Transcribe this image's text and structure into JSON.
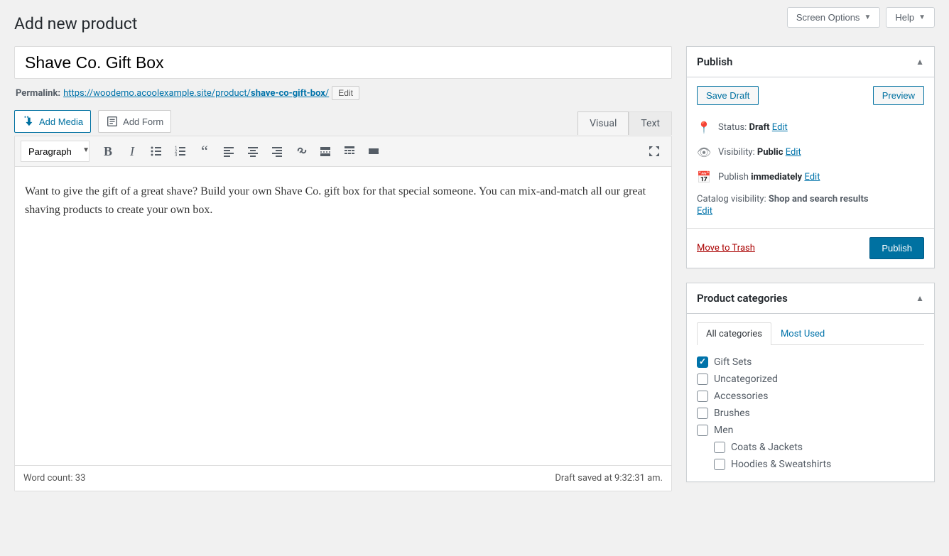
{
  "header": {
    "screen_options": "Screen Options",
    "help": "Help"
  },
  "page_title": "Add new product",
  "title_input": {
    "value": "Shave Co. Gift Box"
  },
  "permalink": {
    "label": "Permalink:",
    "base_url": "https://woodemo.acoolexample.site/product/",
    "slug": "shave-co-gift-box",
    "trailing": "/",
    "edit_label": "Edit"
  },
  "media_buttons": {
    "add_media": "Add Media",
    "add_form": "Add Form"
  },
  "editor": {
    "tab_visual": "Visual",
    "tab_text": "Text",
    "format_selected": "Paragraph",
    "content": "Want to give the gift of a great shave? Build your own Shave Co. gift box for that special someone. You can mix-and-match all our great shaving products to create your own box.",
    "word_count_label": "Word count: ",
    "word_count": "33",
    "draft_saved_label": "Draft saved at ",
    "draft_saved_time": "9:32:31 am."
  },
  "publish": {
    "title": "Publish",
    "save_draft": "Save Draft",
    "preview": "Preview",
    "status_label": "Status: ",
    "status_value": "Draft",
    "visibility_label": "Visibility: ",
    "visibility_value": "Public",
    "publish_label": "Publish ",
    "publish_value": "immediately",
    "catalog_label": "Catalog visibility: ",
    "catalog_value": "Shop and search results",
    "edit": "Edit",
    "trash": "Move to Trash",
    "publish_button": "Publish"
  },
  "categories": {
    "title": "Product categories",
    "tab_all": "All categories",
    "tab_most": "Most Used",
    "items": [
      {
        "label": "Gift Sets",
        "checked": true,
        "child": false
      },
      {
        "label": "Uncategorized",
        "checked": false,
        "child": false
      },
      {
        "label": "Accessories",
        "checked": false,
        "child": false
      },
      {
        "label": "Brushes",
        "checked": false,
        "child": false
      },
      {
        "label": "Men",
        "checked": false,
        "child": false
      },
      {
        "label": "Coats & Jackets",
        "checked": false,
        "child": true
      },
      {
        "label": "Hoodies & Sweatshirts",
        "checked": false,
        "child": true
      }
    ]
  }
}
